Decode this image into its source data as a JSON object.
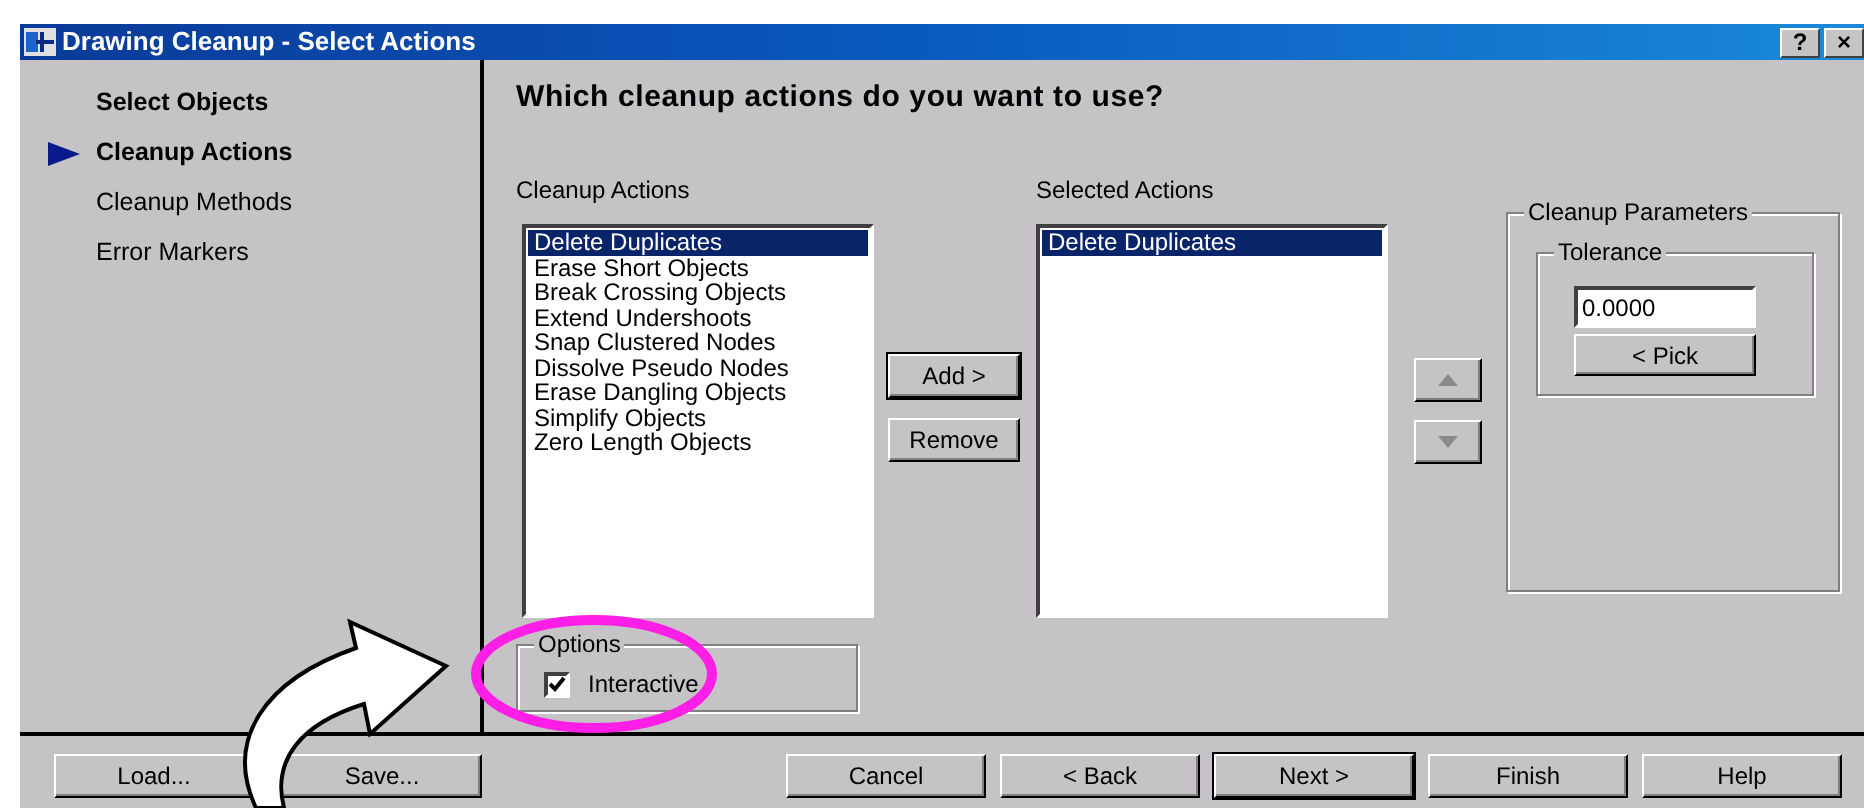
{
  "window": {
    "title": "Drawing Cleanup - Select Actions",
    "title_buttons": [
      "?",
      "×"
    ]
  },
  "steps": [
    {
      "label": "Select Objects",
      "visited": true,
      "selected": false
    },
    {
      "label": "Cleanup Actions",
      "visited": true,
      "selected": true
    },
    {
      "label": "Cleanup Methods",
      "visited": false,
      "selected": false
    },
    {
      "label": "Error Markers",
      "visited": false,
      "selected": false
    }
  ],
  "heading": "Which cleanup actions do you want to use?",
  "available": {
    "label": "Cleanup Actions",
    "items": [
      {
        "text": "Delete Duplicates",
        "selected": true
      },
      {
        "text": "Erase Short Objects",
        "selected": false
      },
      {
        "text": "Break Crossing Objects",
        "selected": false
      },
      {
        "text": "Extend Undershoots",
        "selected": false
      },
      {
        "text": "Snap Clustered Nodes",
        "selected": false
      },
      {
        "text": "Dissolve Pseudo Nodes",
        "selected": false
      },
      {
        "text": "Erase Dangling Objects",
        "selected": false
      },
      {
        "text": "Simplify Objects",
        "selected": false
      },
      {
        "text": "Zero Length Objects",
        "selected": false
      }
    ]
  },
  "transfer_buttons": [
    {
      "label": "Add >",
      "default": true
    },
    {
      "label": "Remove",
      "default": false
    }
  ],
  "chosen": {
    "label": "Selected Actions",
    "items": [
      {
        "text": "Delete Duplicates",
        "selected": true
      }
    ]
  },
  "move_buttons": [
    {
      "kind": "up",
      "disabled": true
    },
    {
      "kind": "down",
      "disabled": true
    }
  ],
  "parameters": {
    "title": "Cleanup Parameters",
    "tolerance": {
      "title": "Tolerance",
      "value": "0.0000",
      "pick_button": "< Pick"
    }
  },
  "options": {
    "title": "Options",
    "checkbox": {
      "label": "Interactive",
      "checked": true
    }
  },
  "footer_buttons": [
    {
      "label": "Load...",
      "default": false
    },
    {
      "label": "Save...",
      "default": false
    },
    {
      "label": "Cancel",
      "default": false
    },
    {
      "label": "< Back",
      "default": false
    },
    {
      "label": "Next >",
      "default": true
    },
    {
      "label": "Finish",
      "default": false
    },
    {
      "label": "Help",
      "default": false
    }
  ]
}
